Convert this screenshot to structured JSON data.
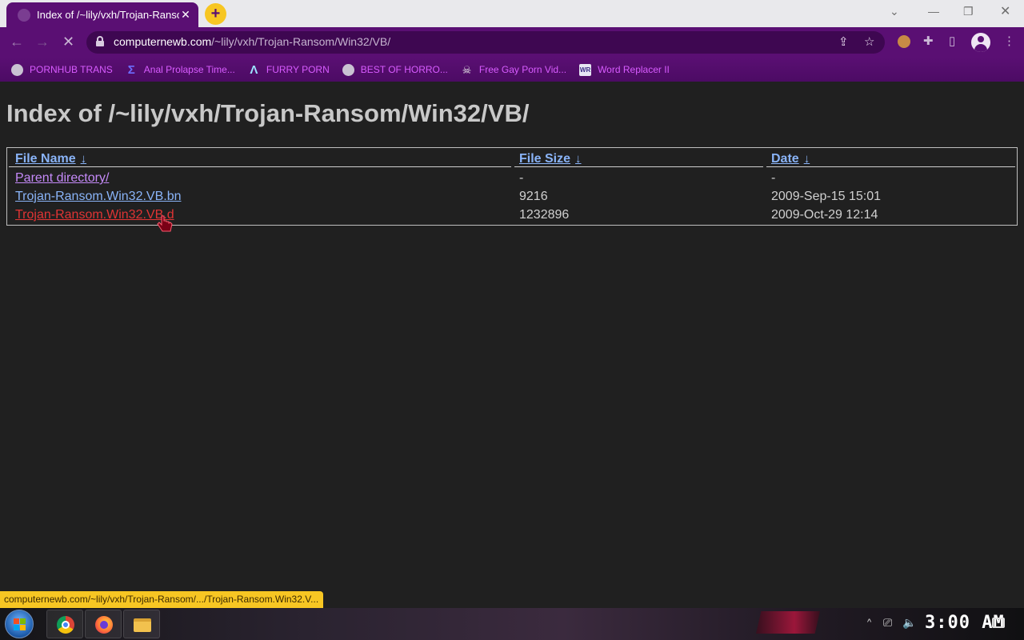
{
  "browser": {
    "tab_title": "Index of /~lily/vxh/Trojan-Ransom/Win32/VB/",
    "tab_close_glyph": "✕",
    "new_tab_glyph": "+",
    "url_domain": "computernewb.com",
    "url_path": "/~lily/vxh/Trojan-Ransom/Win32/VB/",
    "accent_color": "#5a0f73",
    "new_tab_color": "#f7c623"
  },
  "bookmarks": [
    {
      "label": "PORNHUB TRANS",
      "icon": "globe-icon"
    },
    {
      "label": "Anal Prolapse Time...",
      "icon": "sigma-icon"
    },
    {
      "label": "FURRY PORN",
      "icon": "lambda-icon"
    },
    {
      "label": "BEST OF HORRO...",
      "icon": "globe-icon"
    },
    {
      "label": "Free Gay Porn Vid...",
      "icon": "skull-icon"
    },
    {
      "label": "Word Replacer II",
      "icon": "wr-icon"
    }
  ],
  "page": {
    "heading": "Index of /~lily/vxh/Trojan-Ransom/Win32/VB/",
    "columns": {
      "name": "File Name",
      "size": "File Size",
      "date": "Date",
      "sort_glyph": "↓"
    },
    "rows": [
      {
        "name": "Parent directory/",
        "size": "-",
        "date": "-",
        "state": "visited"
      },
      {
        "name": "Trojan-Ransom.Win32.VB.bn",
        "size": "9216",
        "date": "2009-Sep-15 15:01",
        "state": "normal"
      },
      {
        "name": "Trojan-Ransom.Win32.VB.d",
        "size": "1232896",
        "date": "2009-Oct-29 12:14",
        "state": "hover"
      }
    ]
  },
  "status_bar": "computernewb.com/~lily/vxh/Trojan-Ransom/.../Trojan-Ransom.Win32.V...",
  "taskbar": {
    "clock": "3:00 AM",
    "apps": [
      "chrome-icon",
      "firefox-icon",
      "file-explorer-icon"
    ]
  }
}
